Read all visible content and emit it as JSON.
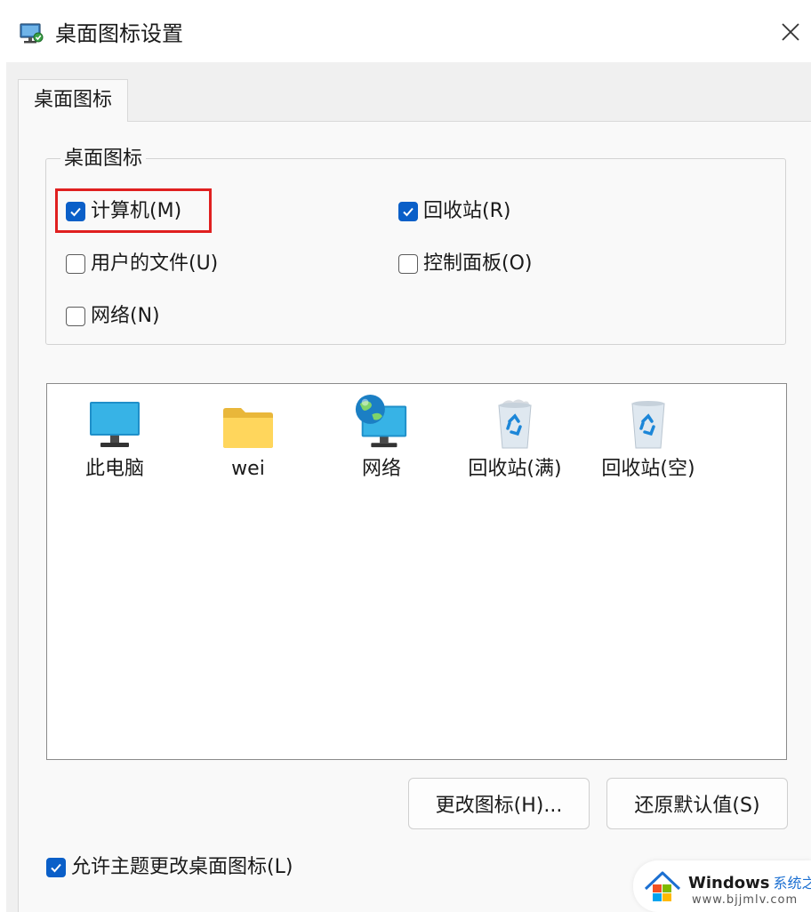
{
  "window": {
    "title": "桌面图标设置",
    "app_icon": "desktop-settings-icon",
    "close_icon": "close-icon"
  },
  "tabs": [
    {
      "label": "桌面图标",
      "selected": true
    }
  ],
  "group": {
    "legend": "桌面图标",
    "checkboxes": [
      {
        "label": "计算机(M)",
        "checked": true
      },
      {
        "label": "回收站(R)",
        "checked": true
      },
      {
        "label": "用户的文件(U)",
        "checked": false
      },
      {
        "label": "控制面板(O)",
        "checked": false
      },
      {
        "label": "网络(N)",
        "checked": false
      }
    ]
  },
  "icons": [
    {
      "label": "此电脑",
      "icon": "monitor-icon"
    },
    {
      "label": "wei",
      "icon": "folder-icon"
    },
    {
      "label": "网络",
      "icon": "network-globe-icon"
    },
    {
      "label": "回收站(满)",
      "icon": "recycle-bin-full-icon"
    },
    {
      "label": "回收站(空)",
      "icon": "recycle-bin-empty-icon"
    }
  ],
  "buttons": {
    "change_icon": "更改图标(H)...",
    "restore_default": "还原默认值(S)"
  },
  "allow_themes": {
    "label": "允许主题更改桌面图标(L)",
    "checked": true
  },
  "watermark": {
    "brand": "Windows",
    "brand_cn": "系统之家",
    "url": "www.bjjmlv.com"
  },
  "colors": {
    "accent": "#0a5fc8",
    "highlight_border": "#e02020",
    "watermark_blue": "#1b6fd1"
  }
}
